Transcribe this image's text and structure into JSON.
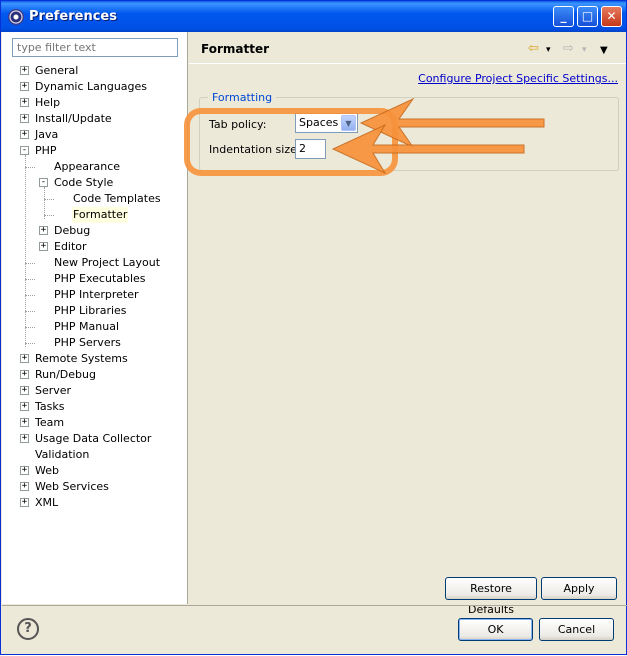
{
  "window": {
    "title": "Preferences",
    "controls": [
      "_",
      "□",
      "✕"
    ]
  },
  "filter": {
    "placeholder": "type filter text"
  },
  "tree": [
    {
      "label": "General",
      "depth": 0,
      "expander": "+"
    },
    {
      "label": "Dynamic Languages",
      "depth": 0,
      "expander": "+"
    },
    {
      "label": "Help",
      "depth": 0,
      "expander": "+"
    },
    {
      "label": "Install/Update",
      "depth": 0,
      "expander": "+"
    },
    {
      "label": "Java",
      "depth": 0,
      "expander": "+"
    },
    {
      "label": "PHP",
      "depth": 0,
      "expander": "-"
    },
    {
      "label": "Appearance",
      "depth": 1,
      "expander": ""
    },
    {
      "label": "Code Style",
      "depth": 1,
      "expander": "-"
    },
    {
      "label": "Code Templates",
      "depth": 2,
      "expander": ""
    },
    {
      "label": "Formatter",
      "depth": 2,
      "expander": "",
      "selected": true
    },
    {
      "label": "Debug",
      "depth": 1,
      "expander": "+"
    },
    {
      "label": "Editor",
      "depth": 1,
      "expander": "+"
    },
    {
      "label": "New Project Layout",
      "depth": 1,
      "expander": ""
    },
    {
      "label": "PHP Executables",
      "depth": 1,
      "expander": ""
    },
    {
      "label": "PHP Interpreter",
      "depth": 1,
      "expander": ""
    },
    {
      "label": "PHP Libraries",
      "depth": 1,
      "expander": ""
    },
    {
      "label": "PHP Manual",
      "depth": 1,
      "expander": ""
    },
    {
      "label": "PHP Servers",
      "depth": 1,
      "expander": ""
    },
    {
      "label": "Remote Systems",
      "depth": 0,
      "expander": "+"
    },
    {
      "label": "Run/Debug",
      "depth": 0,
      "expander": "+"
    },
    {
      "label": "Server",
      "depth": 0,
      "expander": "+"
    },
    {
      "label": "Tasks",
      "depth": 0,
      "expander": "+"
    },
    {
      "label": "Team",
      "depth": 0,
      "expander": "+"
    },
    {
      "label": "Usage Data Collector",
      "depth": 0,
      "expander": "+"
    },
    {
      "label": "Validation",
      "depth": 0,
      "expander": ""
    },
    {
      "label": "Web",
      "depth": 0,
      "expander": "+"
    },
    {
      "label": "Web Services",
      "depth": 0,
      "expander": "+"
    },
    {
      "label": "XML",
      "depth": 0,
      "expander": "+"
    }
  ],
  "page": {
    "title": "Formatter",
    "nav": {
      "back": "⇦",
      "back_menu": "▾",
      "forward": "⇨",
      "forward_menu": "▾",
      "view_menu": "▼"
    },
    "configure_link": "Configure Project Specific Settings...",
    "group_label": "Formatting",
    "tab_policy": {
      "label": "Tab policy:",
      "value": "Spaces"
    },
    "indentation": {
      "label": "Indentation size:",
      "value": "2"
    },
    "restore_defaults": "Restore Defaults",
    "apply": "Apply"
  },
  "footer": {
    "help": "?",
    "ok": "OK",
    "cancel": "Cancel"
  },
  "colors": {
    "title_bar": "#0058EE",
    "annotation": "#F7923A",
    "link": "#0000CC",
    "legend": "#0046D5"
  }
}
